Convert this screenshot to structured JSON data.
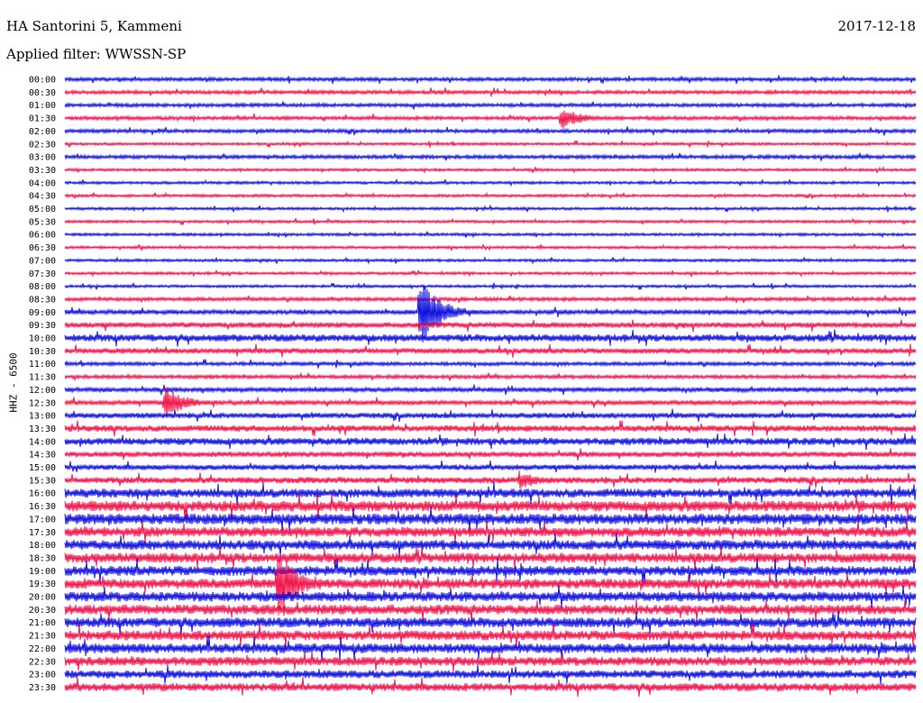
{
  "header": {
    "station": "HA Santorini 5, Kammeni",
    "date": "2017-12-18",
    "filter": "Applied filter: WWSSN-SP",
    "channel": "HHZ - 6500"
  },
  "colors": {
    "blue": "#1010e0",
    "red": "#f0144c"
  },
  "chart_data": {
    "type": "line",
    "title": "HA Santorini 5, Kammeni",
    "ylabel": "HHZ - 6500",
    "rows": [
      "00:00",
      "00:30",
      "01:00",
      "01:30",
      "02:00",
      "02:30",
      "03:00",
      "03:30",
      "04:00",
      "04:30",
      "05:00",
      "05:30",
      "06:00",
      "06:30",
      "07:00",
      "07:30",
      "08:00",
      "08:30",
      "09:00",
      "09:30",
      "10:00",
      "10:30",
      "11:00",
      "11:30",
      "12:00",
      "12:30",
      "13:00",
      "13:30",
      "14:00",
      "14:30",
      "15:00",
      "15:30",
      "16:00",
      "16:30",
      "17:00",
      "17:30",
      "18:00",
      "18:30",
      "19:00",
      "19:30",
      "20:00",
      "20:30",
      "21:00",
      "21:30",
      "22:00",
      "22:30",
      "23:00",
      "23:30"
    ],
    "row_noise": [
      2,
      2,
      2,
      2,
      2,
      1.5,
      2,
      1.5,
      1.5,
      1.5,
      1.5,
      1.5,
      1.5,
      1.5,
      1.5,
      1.5,
      1.5,
      2,
      2.5,
      3,
      4,
      3,
      2,
      2,
      2.5,
      2.5,
      3,
      3.5,
      4,
      3,
      3,
      3.5,
      5,
      6,
      6,
      5.5,
      5.5,
      5.5,
      5.5,
      5.5,
      5.5,
      5.5,
      5.5,
      5.5,
      5.5,
      5,
      4.5,
      4.5
    ],
    "events": [
      {
        "row": "01:30",
        "minute": 17.5,
        "amplitude": 14
      },
      {
        "row": "09:00",
        "minute": 12.5,
        "amplitude": 40
      },
      {
        "row": "12:30",
        "minute": 3.5,
        "amplitude": 20
      },
      {
        "row": "15:30",
        "minute": 16,
        "amplitude": 12
      },
      {
        "row": "19:30",
        "minute": 7.5,
        "amplitude": 40
      }
    ]
  }
}
